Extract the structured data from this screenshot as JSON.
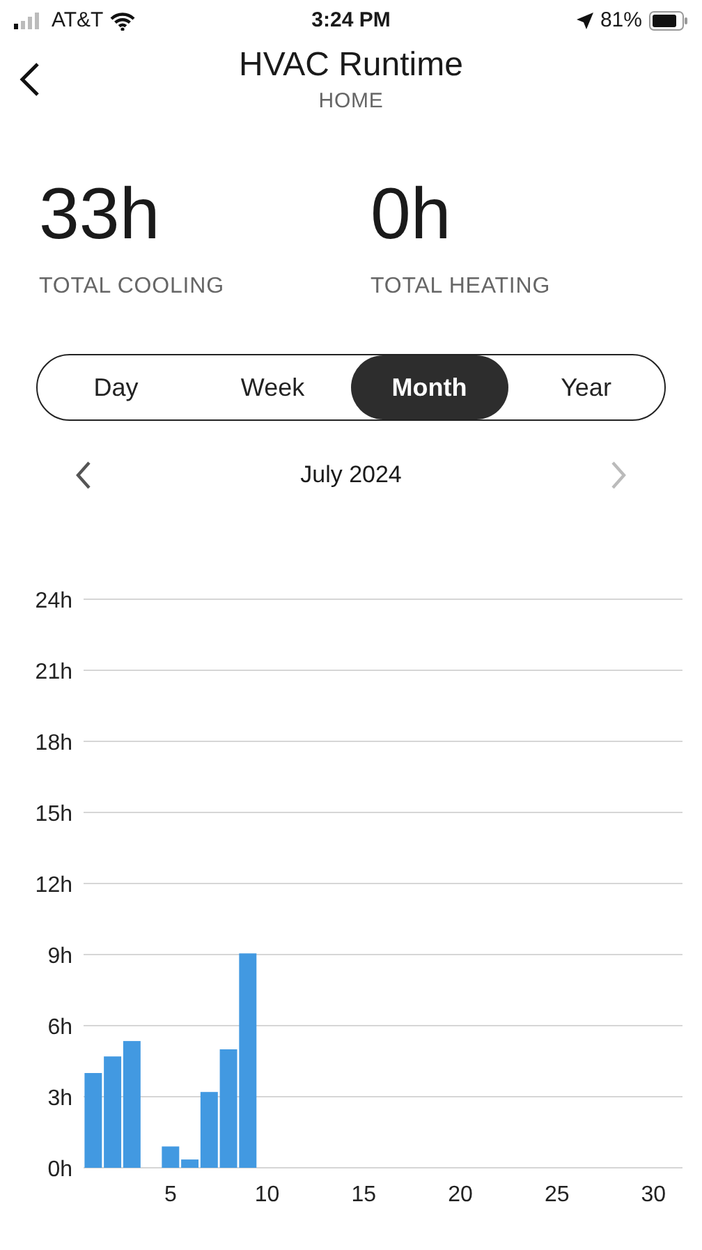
{
  "status_bar": {
    "carrier": "AT&T",
    "time": "3:24 PM",
    "battery": "81%"
  },
  "header": {
    "title": "HVAC Runtime",
    "subtitle": "HOME"
  },
  "stats": [
    {
      "value": "33h",
      "label": "TOTAL COOLING"
    },
    {
      "value": "0h",
      "label": "TOTAL HEATING"
    }
  ],
  "tabs": [
    {
      "label": "Day",
      "selected": false
    },
    {
      "label": "Week",
      "selected": false
    },
    {
      "label": "Month",
      "selected": true
    },
    {
      "label": "Year",
      "selected": false
    }
  ],
  "period": {
    "label": "July 2024",
    "next_disabled": true
  },
  "chart": {
    "chart_data": {
      "type": "bar",
      "x": [
        1,
        2,
        3,
        5,
        6,
        7,
        8,
        9
      ],
      "series": [
        {
          "color": "#4299e1",
          "values": [
            4.0,
            4.7,
            5.35,
            0.9,
            0.35,
            3.2,
            5.0,
            9.05
          ]
        }
      ],
      "xlim": [
        0.5,
        31.5
      ],
      "ylim": [
        0,
        24
      ],
      "grid": true,
      "yticks": [
        {
          "value": 0,
          "label": "0h"
        },
        {
          "value": 3,
          "label": "3h"
        },
        {
          "value": 6,
          "label": "6h"
        },
        {
          "value": 9,
          "label": "9h"
        },
        {
          "value": 12,
          "label": "12h"
        },
        {
          "value": 15,
          "label": "15h"
        },
        {
          "value": 18,
          "label": "18h"
        },
        {
          "value": 21,
          "label": "21h"
        },
        {
          "value": 24,
          "label": "24h"
        }
      ],
      "xticks": [
        5,
        10,
        15,
        20,
        25,
        30
      ]
    }
  }
}
